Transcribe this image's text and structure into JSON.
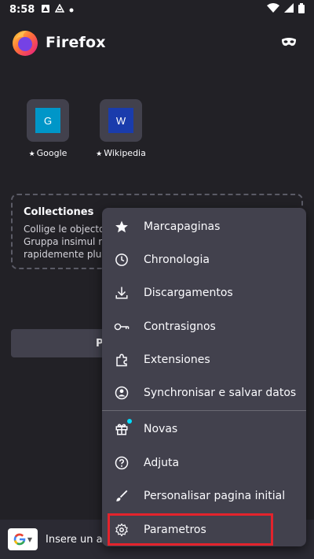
{
  "status_bar": {
    "time": "8:58"
  },
  "header": {
    "brand": "Firefox"
  },
  "shortcuts": [
    {
      "letter": "G",
      "label": "Google",
      "color": "#0096c8"
    },
    {
      "letter": "W",
      "label": "Wikipedia",
      "color": "#1a3cac"
    }
  ],
  "collections": {
    "title": "Collectiones",
    "desc_lines": [
      "Collige le objectos",
      "Gruppa insimul rec",
      "rapidemente plus t"
    ]
  },
  "partial_button": {
    "label": "P"
  },
  "toolbar": {
    "address_placeholder": "Insere un ad"
  },
  "menu": {
    "items": [
      {
        "label": "Marcapaginas",
        "icon": "star-icon"
      },
      {
        "label": "Chronologia",
        "icon": "clock-icon"
      },
      {
        "label": "Discargamentos",
        "icon": "download-icon"
      },
      {
        "label": "Contrasignos",
        "icon": "key-icon"
      },
      {
        "label": "Extensiones",
        "icon": "puzzle-icon"
      },
      {
        "label": "Synchronisar e salvar datos",
        "icon": "account-icon"
      },
      {
        "label": "Novas",
        "icon": "gift-icon"
      },
      {
        "label": "Adjuta",
        "icon": "help-icon"
      },
      {
        "label": "Personalisar pagina initial",
        "icon": "brush-icon"
      },
      {
        "label": "Parametros",
        "icon": "gear-icon"
      }
    ]
  },
  "colors": {
    "background": "#222126",
    "menu": "#42414d",
    "highlight": "#e3232c",
    "notification_dot": "#00ddff"
  }
}
